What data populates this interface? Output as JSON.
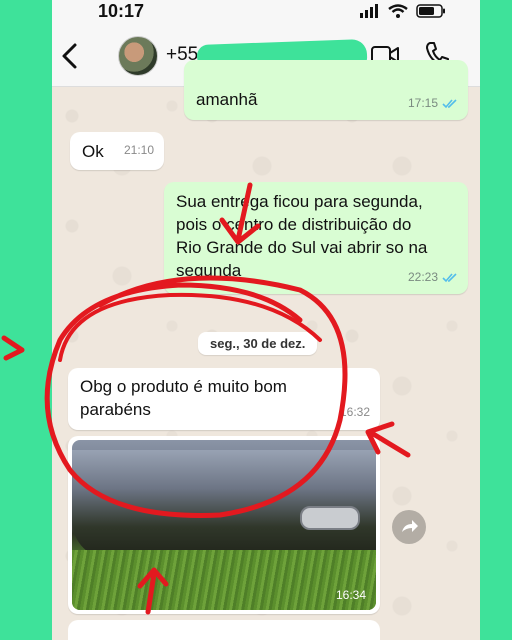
{
  "status_bar": {
    "time": "10:17"
  },
  "header": {
    "contact_name": "+55 3"
  },
  "messages": [
    {
      "text": "amanhã",
      "time": "17:15"
    },
    {
      "text": "Ok",
      "time": "21:10"
    },
    {
      "text": "Sua entrega ficou para segunda,\npois o centro de distribuição do\nRio Grande do Sul vai abrir so na\nsegunda",
      "time": "22:23"
    },
    {
      "text": "Obg o produto é muito bom\nparabéns",
      "time": "16:32"
    }
  ],
  "date_separator": "seg., 30 de dez.",
  "photo_message": {
    "time": "16:34"
  },
  "colors": {
    "page_background": "#3ee29a",
    "outgoing_bubble": "#d9fdd3",
    "incoming_bubble": "#ffffff",
    "read_ticks": "#53bdeb",
    "annotation_red": "#e3191f"
  },
  "icons": [
    "back-chevron-icon",
    "video-call-icon",
    "phone-call-icon",
    "signal-icon",
    "wifi-icon",
    "battery-icon",
    "read-receipt-icon",
    "forward-icon"
  ]
}
